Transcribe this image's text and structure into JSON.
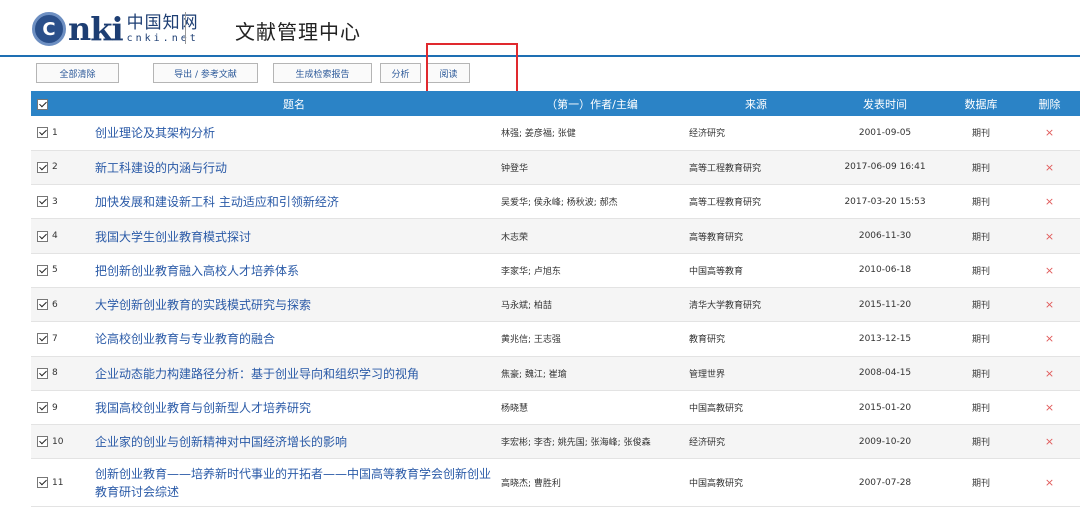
{
  "header": {
    "logo_letter": "C",
    "logo_word": "nki",
    "logo_cn": "中国知网",
    "logo_url": "cnki.net",
    "title": "文献管理中心"
  },
  "toolbar": {
    "clear_all": "全部清除",
    "export": "导出 / 参考文献",
    "report": "生成检索报告",
    "analyze": "分析",
    "read": "阅读"
  },
  "table": {
    "headers": {
      "title": "题名",
      "author": "（第一）作者/主编",
      "source": "来源",
      "date": "发表时间",
      "db": "数据库",
      "del": "删除"
    },
    "delete_symbol": "×",
    "rows": [
      {
        "idx": "1",
        "title": "创业理论及其架构分析",
        "author": "林强; 姜彦福; 张健",
        "source": "经济研究",
        "date": "2001-09-05",
        "db": "期刊"
      },
      {
        "idx": "2",
        "title": "新工科建设的内涵与行动",
        "author": "钟登华",
        "source": "高等工程教育研究",
        "date": "2017-06-09 16:41",
        "db": "期刊"
      },
      {
        "idx": "3",
        "title": "加快发展和建设新工科  主动适应和引领新经济",
        "author": "吴爱华; 侯永峰; 杨秋波; 郝杰",
        "source": "高等工程教育研究",
        "date": "2017-03-20 15:53",
        "db": "期刊"
      },
      {
        "idx": "4",
        "title": "我国大学生创业教育模式探讨",
        "author": "木志荣",
        "source": "高等教育研究",
        "date": "2006-11-30",
        "db": "期刊"
      },
      {
        "idx": "5",
        "title": "把创新创业教育融入高校人才培养体系",
        "author": "李家华; 卢旭东",
        "source": "中国高等教育",
        "date": "2010-06-18",
        "db": "期刊"
      },
      {
        "idx": "6",
        "title": "大学创新创业教育的实践模式研究与探索",
        "author": "马永斌; 柏喆",
        "source": "清华大学教育研究",
        "date": "2015-11-20",
        "db": "期刊"
      },
      {
        "idx": "7",
        "title": "论高校创业教育与专业教育的融合",
        "author": "黄兆信; 王志强",
        "source": "教育研究",
        "date": "2013-12-15",
        "db": "期刊"
      },
      {
        "idx": "8",
        "title": "企业动态能力构建路径分析：基于创业导向和组织学习的视角",
        "author": "焦豪; 魏江; 崔瑜",
        "source": "管理世界",
        "date": "2008-04-15",
        "db": "期刊"
      },
      {
        "idx": "9",
        "title": "我国高校创业教育与创新型人才培养研究",
        "author": "杨晓慧",
        "source": "中国高教研究",
        "date": "2015-01-20",
        "db": "期刊"
      },
      {
        "idx": "10",
        "title": "企业家的创业与创新精神对中国经济增长的影响",
        "author": "李宏彬; 李杏; 姚先国; 张海峰; 张俊森",
        "source": "经济研究",
        "date": "2009-10-20",
        "db": "期刊"
      },
      {
        "idx": "11",
        "title": "创新创业教育——培养新时代事业的开拓者——中国高等教育学会创新创业教育研讨会综述",
        "author": "高晓杰; 曹胜利",
        "source": "中国高教研究",
        "date": "2007-07-28",
        "db": "期刊"
      }
    ]
  }
}
